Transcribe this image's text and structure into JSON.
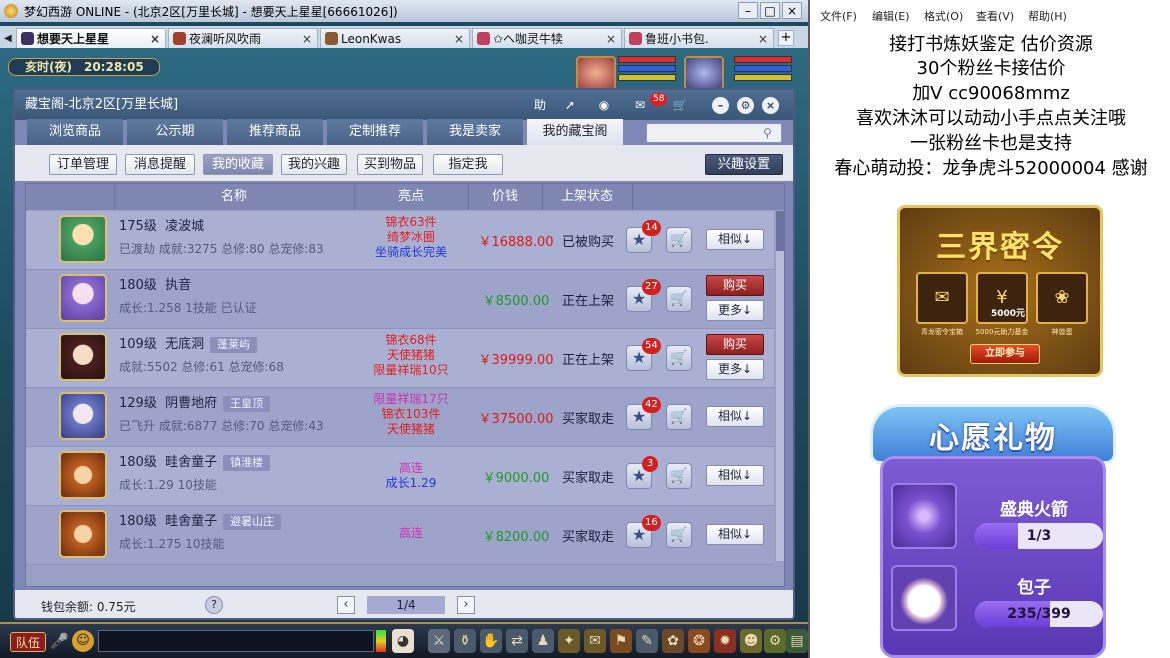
{
  "window": {
    "title": "梦幻西游 ONLINE - (北京2区[万里长城] - 想要天上星星[66661026])",
    "tabs": [
      {
        "label": "想要天上星星",
        "active": true
      },
      {
        "label": "夜澜听风吹雨",
        "active": false
      },
      {
        "label": "LeonKwas",
        "active": false
      },
      {
        "label": "✩ヘ咖灵牛犊",
        "active": false
      },
      {
        "label": "鲁班小书包.",
        "active": false
      }
    ],
    "add_tab": "+"
  },
  "clock": {
    "period": "亥时(夜)",
    "time": "20:28:05"
  },
  "shop": {
    "title": "藏宝阁-北京2区[万里长城]",
    "header_icons": {
      "help": "助",
      "mail_badge": "58"
    },
    "main_tabs": [
      "浏览商品",
      "公示期",
      "推荐商品",
      "定制推荐",
      "我是卖家",
      "我的藏宝阁"
    ],
    "active_main_tab": "我的藏宝阁",
    "search_placeholder": "",
    "sub_tabs": [
      "订单管理",
      "消息提醒",
      "我的收藏",
      "我的兴趣",
      "买到物品",
      "指定我"
    ],
    "active_sub_tab": "我的收藏",
    "interest_settings": "兴趣设置",
    "columns": [
      "名称",
      "亮点",
      "价钱",
      "上架状态"
    ],
    "rows": [
      {
        "level": "175级",
        "name": "凌波城",
        "server": "",
        "desc": "已渡劫 成就:3275 总修:80 总宠修:83",
        "highlights": [
          {
            "text": "锦衣63件",
            "color": "red"
          },
          {
            "text": "绮梦冰圈",
            "color": "red"
          },
          {
            "text": "坐骑成长完美",
            "color": "blue"
          }
        ],
        "price": "￥16888.00",
        "price_color": "red",
        "status": "已被购买",
        "fav_count": "14",
        "actions": [
          "相似↓"
        ]
      },
      {
        "level": "180级",
        "name": "执音",
        "server": "",
        "desc": "成长:1.258 1技能 已认证",
        "highlights": [],
        "price": "￥8500.00",
        "price_color": "green",
        "status": "正在上架",
        "fav_count": "27",
        "actions": [
          "购买",
          "更多↓"
        ]
      },
      {
        "level": "109级",
        "name": "无底洞",
        "server": "蓬莱屿",
        "desc": "成就:5502 总修:61 总宠修:68",
        "highlights": [
          {
            "text": "锦衣68件",
            "color": "red"
          },
          {
            "text": "天使猪猪",
            "color": "red"
          },
          {
            "text": "限量祥瑞10只",
            "color": "red"
          }
        ],
        "price": "￥39999.00",
        "price_color": "red",
        "status": "正在上架",
        "fav_count": "54",
        "actions": [
          "购买",
          "更多↓"
        ]
      },
      {
        "level": "129级",
        "name": "阴曹地府",
        "server": "王皇顶",
        "desc": "已飞升 成就:6877 总修:70 总宠修:43",
        "highlights": [
          {
            "text": "限量祥瑞17只",
            "color": "pink"
          },
          {
            "text": "锦衣103件",
            "color": "red"
          },
          {
            "text": "天使猪猪",
            "color": "red"
          }
        ],
        "price": "￥37500.00",
        "price_color": "red",
        "status": "买家取走",
        "fav_count": "42",
        "actions": [
          "相似↓"
        ]
      },
      {
        "level": "180级",
        "name": "畦舍童子",
        "server": "镇淮楼",
        "desc": "成长:1.29 10技能",
        "highlights": [
          {
            "text": "高连",
            "color": "pink"
          },
          {
            "text": "成长1.29",
            "color": "blue"
          }
        ],
        "price": "￥9000.00",
        "price_color": "green",
        "status": "买家取走",
        "fav_count": "3",
        "actions": [
          "相似↓"
        ]
      },
      {
        "level": "180级",
        "name": "畦舍童子",
        "server": "避暑山庄",
        "desc": "成长:1.275 10技能",
        "highlights": [
          {
            "text": "高连",
            "color": "pink"
          }
        ],
        "price": "￥8200.00",
        "price_color": "green",
        "status": "买家取走",
        "fav_count": "16",
        "actions": [
          "相似↓"
        ]
      }
    ],
    "footer": {
      "balance": "钱包余额: 0.75元",
      "help": "?",
      "page": "1/4",
      "prev": "‹",
      "next": "›"
    }
  },
  "hud": {
    "team": "队伍"
  },
  "notepad": {
    "menu": [
      "文件(F)",
      "编辑(E)",
      "格式(O)",
      "查看(V)",
      "帮助(H)"
    ],
    "lines": [
      "接打书炼妖鉴定 估价资源",
      "30个粉丝卡接估价",
      "加V   cc90068mmz",
      "喜欢沐沐可以动动小手点点关注哦",
      "一张粉丝卡也是支持",
      "春心萌动投：龙争虎斗52000004 感谢"
    ]
  },
  "promo_card": {
    "title": "三界密令",
    "items": [
      "青龙密令宝箱",
      "5000元助力基金",
      "神兽蛋"
    ],
    "amount": "5000元",
    "button": "立即参与"
  },
  "wish_card": {
    "title": "心愿礼物",
    "gifts": [
      {
        "name": "盛典火箭",
        "progress": "1/3",
        "fraction": 0.3333
      },
      {
        "name": "包子",
        "progress": "235/399",
        "fraction": 0.589
      }
    ]
  }
}
